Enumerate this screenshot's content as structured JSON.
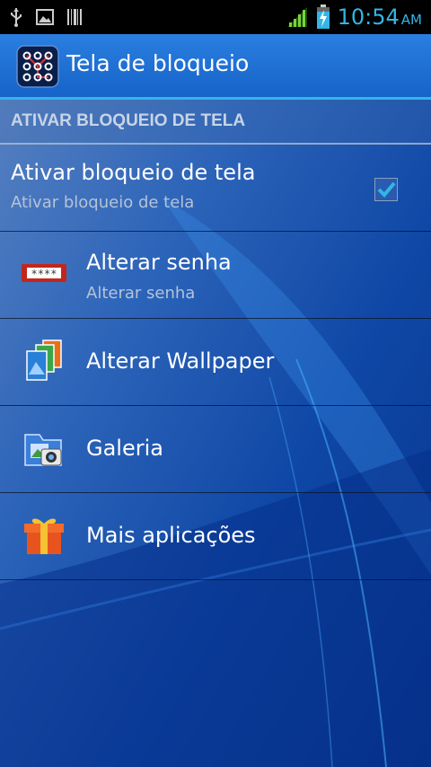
{
  "status_bar": {
    "time": "10:54",
    "ampm": "AM",
    "icons": [
      "usb-icon",
      "image-icon",
      "barcode-icon",
      "signal-icon",
      "battery-charging-icon"
    ]
  },
  "action_bar": {
    "title": "Tela de bloqueio",
    "icon": "lock-pattern-icon"
  },
  "section": {
    "header": "ATIVAR BLOQUEIO DE TELA"
  },
  "items": [
    {
      "title": "Ativar bloqueio de tela",
      "subtitle": "Ativar bloqueio de tela",
      "checked": true
    },
    {
      "title": "Alterar senha",
      "subtitle": "Alterar senha",
      "icon": "password-icon"
    },
    {
      "title": "Alterar Wallpaper",
      "icon": "wallpaper-icon"
    },
    {
      "title": "Galeria",
      "icon": "gallery-icon"
    },
    {
      "title": "Mais aplicações",
      "icon": "gift-icon"
    }
  ],
  "colors": {
    "accent": "#33b5e5",
    "background": "#0b3f98",
    "action_bar": "#1a6ad0"
  }
}
